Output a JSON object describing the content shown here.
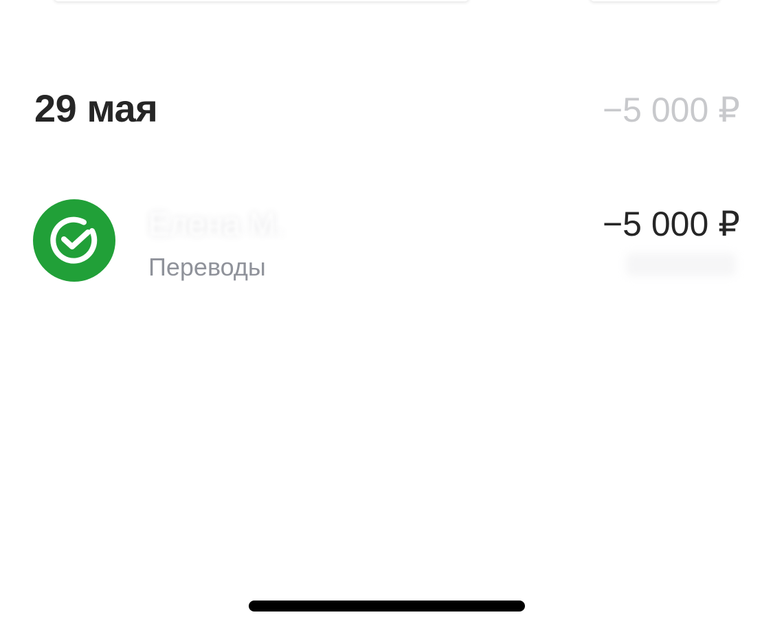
{
  "header": {
    "date": "29 мая",
    "total": "−5 000 ₽"
  },
  "transactions": [
    {
      "name": "Елена М.",
      "category": "Переводы",
      "amount": "−5 000 ₽",
      "icon": "sber-check-icon"
    }
  ],
  "colors": {
    "accent_green": "#21a038",
    "muted_text": "#8f929a",
    "faint_text": "#c8c9cc",
    "primary_text": "#262626"
  }
}
